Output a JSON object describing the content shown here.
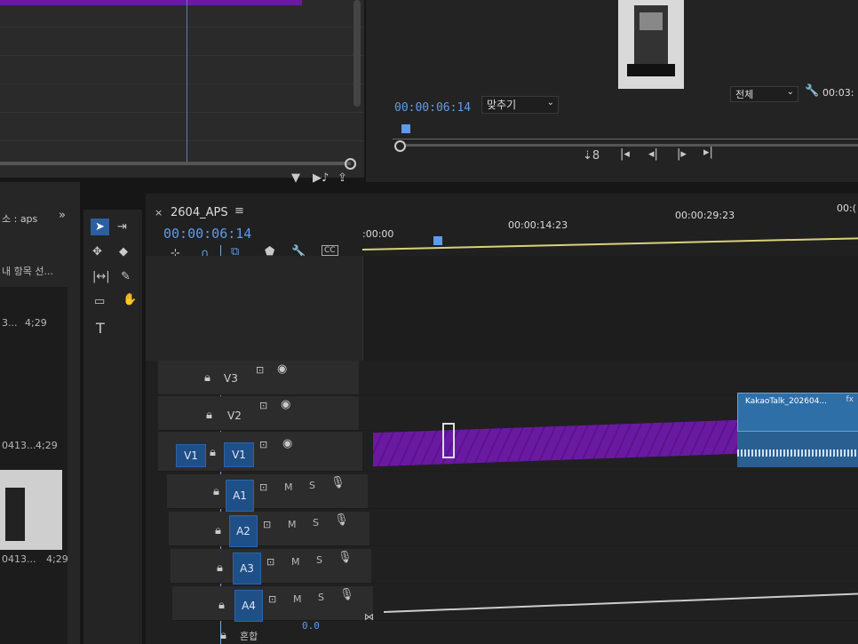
{
  "source_monitor": {
    "visible": true
  },
  "program_monitor": {
    "timecode": "00:00:06:14",
    "fit_label": "맞추기",
    "quality_label": "전체",
    "right_timecode": "00:03:"
  },
  "project_panel": {
    "title": "소 : aps",
    "search_hint": "내 항목 선...",
    "items": [
      {
        "name": "3...",
        "duration": "4;29"
      },
      {
        "name": "0413...",
        "duration": "4;29"
      },
      {
        "name": "0413...",
        "duration": "4;29"
      }
    ]
  },
  "sequence": {
    "name": "2604_APS",
    "timecode": "00:00:06:14",
    "ruler": [
      ":00:00",
      "00:00:14:23",
      "00:00:29:23",
      "00:("
    ],
    "clip_name": "KakaoTalk_202604...",
    "tracks": {
      "video": [
        {
          "label": "V3"
        },
        {
          "label": "V2"
        },
        {
          "label": "V1",
          "source_patch": "V1"
        }
      ],
      "audio": [
        {
          "label": "A1",
          "m": "M",
          "s": "S"
        },
        {
          "label": "A2",
          "m": "M",
          "s": "S"
        },
        {
          "label": "A3",
          "m": "M",
          "s": "S"
        },
        {
          "label": "A4",
          "m": "M",
          "s": "S"
        }
      ],
      "mix_label": "혼합",
      "mix_value": "0.0"
    }
  },
  "colors": {
    "purple_clip": "#6a1aa0",
    "timecode_blue": "#5f9bea",
    "track_blue": "#1f4f87",
    "playhead": "#7fa7e0",
    "work_area": "#d8d27a"
  }
}
